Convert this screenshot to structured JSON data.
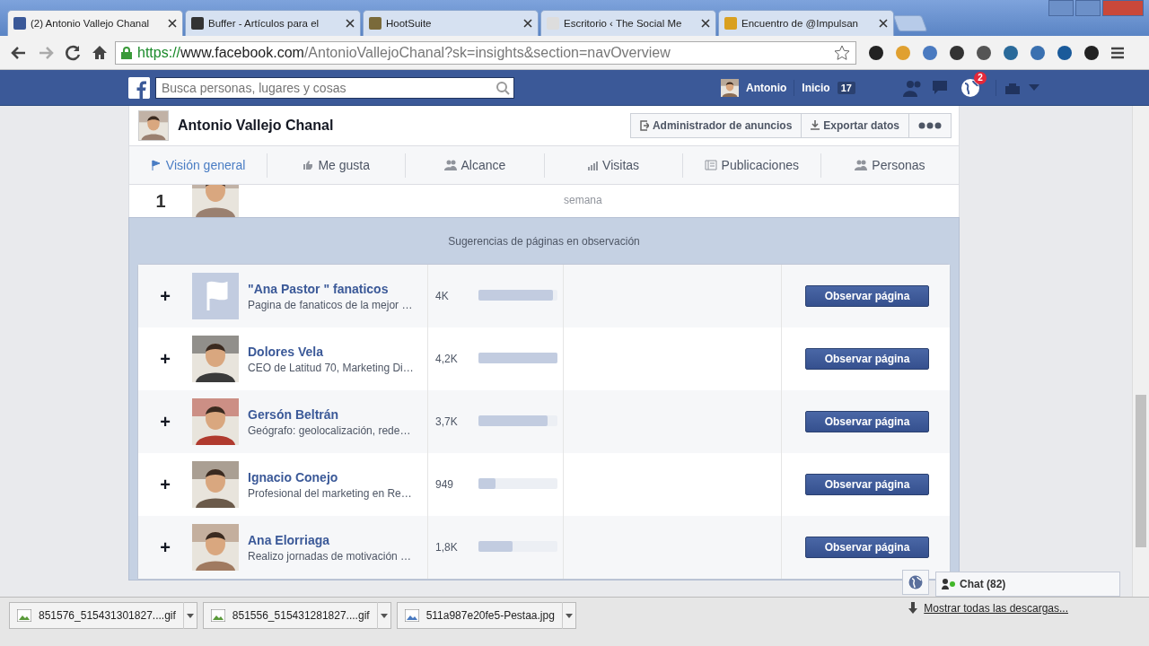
{
  "browser_tabs": [
    {
      "title": "(2) Antonio Vallejo Chanal",
      "selected": true
    },
    {
      "title": "Buffer - Artículos para el",
      "selected": false
    },
    {
      "title": "HootSuite",
      "selected": false
    },
    {
      "title": "Escritorio ‹ The Social Me",
      "selected": false
    },
    {
      "title": "Encuentro de @Impulsan",
      "selected": false
    }
  ],
  "address": {
    "scheme": "https://",
    "host": "www.facebook.com",
    "path": "/AntonioVallejoChanal?sk=insights&section=navOverview"
  },
  "fb_bar": {
    "search_placeholder": "Busca personas, lugares y cosas",
    "user": "Antonio",
    "home": "Inicio",
    "home_count": "17",
    "notifications": "2"
  },
  "page_header": {
    "title": "Antonio Vallejo Chanal",
    "buttons": [
      "Administrador de anuncios",
      "Exportar datos"
    ]
  },
  "nav_tabs": [
    {
      "label": "Visión general",
      "selected": true
    },
    {
      "label": "Me gusta",
      "selected": false
    },
    {
      "label": "Alcance",
      "selected": false
    },
    {
      "label": "Visitas",
      "selected": false
    },
    {
      "label": "Publicaciones",
      "selected": false
    },
    {
      "label": "Personas",
      "selected": false
    }
  ],
  "partial_row": {
    "rank": "1",
    "note": "semana"
  },
  "suggestions": {
    "title": "Sugerencias de páginas en observación",
    "rows": [
      {
        "plus": "+",
        "name": "\"Ana Pastor \" fanaticos",
        "description": "Pagina de fanaticos de la mejor …",
        "count": "4K",
        "level": 0.94,
        "kind": "flag",
        "button": "Observar página"
      },
      {
        "plus": "+",
        "name": "Dolores Vela",
        "description": "CEO de Latitud 70, Marketing Di…",
        "count": "4,2K",
        "level": 1,
        "button": "Observar página"
      },
      {
        "plus": "+",
        "name": "Gersón Beltrán",
        "description": "Geógrafo: geolocalización, rede…",
        "count": "3,7K",
        "level": 0.87,
        "button": "Observar página"
      },
      {
        "plus": "+",
        "name": "Ignacio Conejo",
        "description": "Profesional del marketing en Re…",
        "count": "949",
        "level": 0.22,
        "button": "Observar página"
      },
      {
        "plus": "+",
        "name": "Ana Elorriaga",
        "description": "Realizo jornadas de motivación …",
        "count": "1,8K",
        "level": 0.43,
        "button": "Observar página"
      }
    ]
  },
  "chat": {
    "label": "Chat (82)"
  },
  "downloads": {
    "files": [
      "851576_515431301827....gif",
      "851556_515431281827....gif",
      "511a987e20fe5-Pestaa.jpg"
    ],
    "show_all": "Mostrar todas las descargas..."
  }
}
